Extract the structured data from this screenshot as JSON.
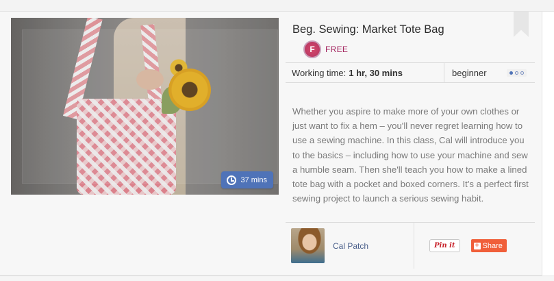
{
  "course": {
    "title": "Beg. Sewing: Market Tote Bag",
    "price_badge_letter": "F",
    "price_label": "FREE",
    "duration": "37 mins",
    "working_time_label": "Working time:",
    "working_time_value": "1 hr, 30 mins",
    "level": "beginner",
    "level_dots_filled": 1,
    "level_dots_total": 3,
    "description": "Whether you aspire to make more of your own clothes or just want to fix a hem – you'll never regret learning how to use a sewing machine. In this class, Cal will introduce you to the basics – including how to use your machine and sew a humble seam. Then she'll teach you how to make a lined tote bag with a pocket and boxed corners. It's a perfect first sewing project to launch a serious sewing habit."
  },
  "author": {
    "name": "Cal Patch"
  },
  "actions": {
    "pin_label": "Pin it",
    "share_label": "Share"
  },
  "icons": {
    "duration": "clock-icon",
    "bookmark": "bookmark-icon",
    "share": "plus-icon"
  },
  "colors": {
    "accent_blue": "#4f73b8",
    "price_magenta": "#a3245f",
    "share_orange": "#f05f3a",
    "pin_red": "#c8232c"
  }
}
